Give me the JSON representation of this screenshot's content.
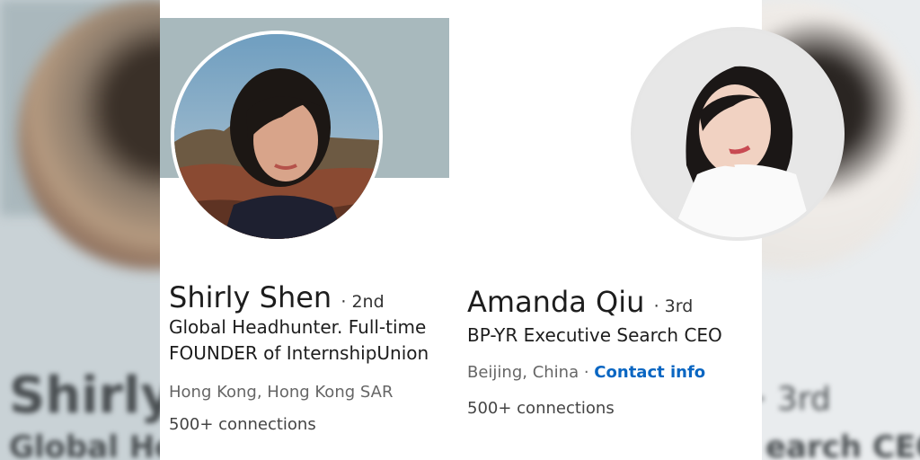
{
  "profiles": [
    {
      "name": "Shirly Shen",
      "degree": "· 2nd",
      "headline_line1": "Global Headhunter. Full-time",
      "headline_line2": "FOUNDER of InternshipUnion",
      "location": "Hong Kong, Hong Kong SAR",
      "connections": "500+ connections"
    },
    {
      "name": "Amanda Qiu",
      "degree": "· 3rd",
      "headline": "BP-YR Executive Search CEO",
      "location": "Beijing, China",
      "separator": " · ",
      "contact_link": "Contact info",
      "connections": "500+ connections"
    }
  ],
  "blurred_background": {
    "left_name": "Shirly S",
    "left_headline": "Global He",
    "right_degree": "· 3rd",
    "right_headline": "earch CEO"
  },
  "colors": {
    "link": "#0a66c2",
    "banner": "#a8b9bd"
  }
}
